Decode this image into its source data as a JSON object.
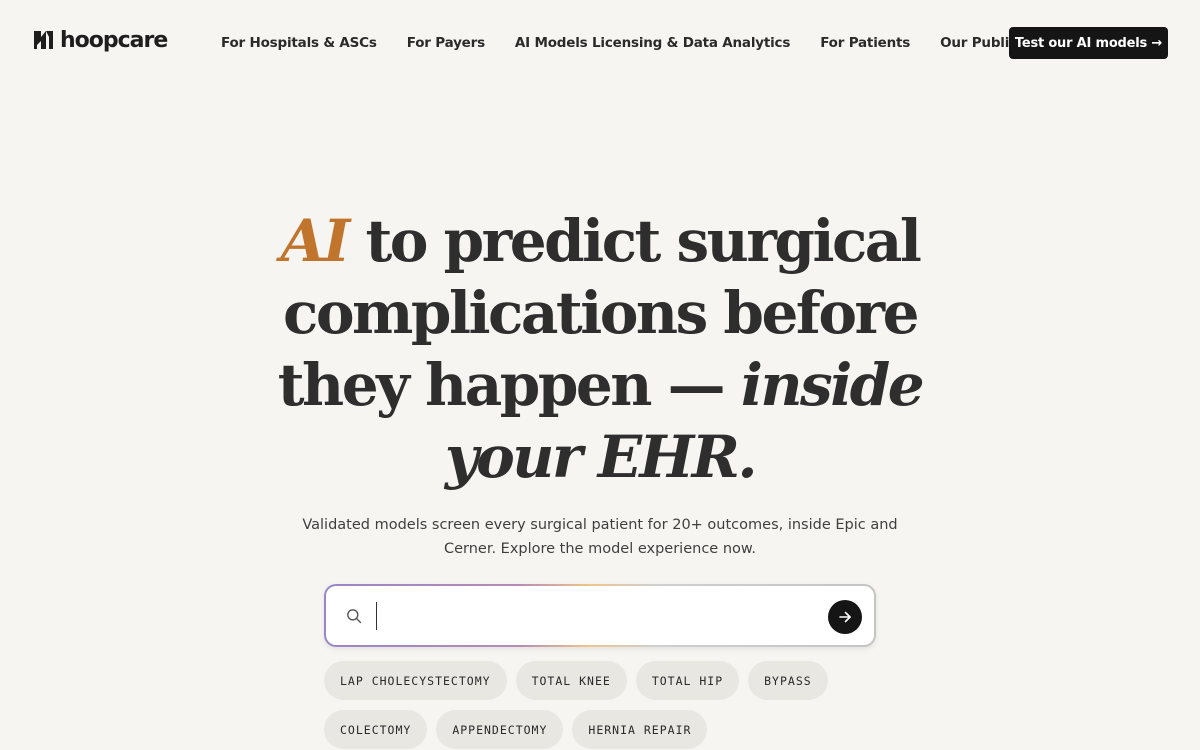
{
  "brand": {
    "name": "hoopcare",
    "logo_icon": "hoopcare-logo-mark"
  },
  "nav": {
    "items": [
      {
        "label": "For Hospitals & ASCs"
      },
      {
        "label": "For Payers"
      },
      {
        "label": "AI Models Licensing & Data Analytics"
      },
      {
        "label": "For Patients"
      },
      {
        "label": "Our Publications"
      }
    ],
    "cta_label": "Test our AI models →"
  },
  "hero": {
    "headline_ai": "AI",
    "headline_line1_rest": "to predict surgical",
    "headline_line2": "complications before",
    "headline_line3_regular": "they happen —",
    "headline_line3_italic": "inside",
    "headline_line4_italic": "your EHR.",
    "subtext": "Validated models screen every surgical patient for 20+ outcomes, inside Epic and Cerner. Explore the model experience now.",
    "accent_color": "#c0742c"
  },
  "search": {
    "value": "",
    "placeholder": "",
    "icon": "search-icon",
    "submit_icon": "arrow-right-icon"
  },
  "chips": [
    {
      "label": "LAP CHOLECYSTECTOMY"
    },
    {
      "label": "TOTAL KNEE"
    },
    {
      "label": "TOTAL HIP"
    },
    {
      "label": "BYPASS"
    },
    {
      "label": "COLECTOMY"
    },
    {
      "label": "APPENDECTOMY"
    },
    {
      "label": "HERNIA REPAIR"
    }
  ]
}
